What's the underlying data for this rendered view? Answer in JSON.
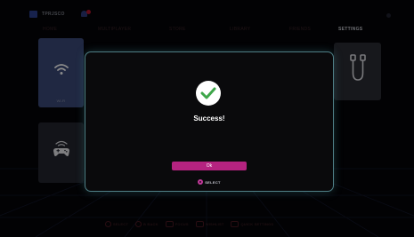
{
  "app": {
    "brand": "TPRJSCO"
  },
  "tabs": [
    {
      "label": "HOME",
      "active": false
    },
    {
      "label": "MULTIPLAYER",
      "active": false
    },
    {
      "label": "STORE",
      "active": false
    },
    {
      "label": "LIBRARY",
      "active": false
    },
    {
      "label": "FRIENDS",
      "active": false
    },
    {
      "label": "SETTINGS",
      "active": true
    }
  ],
  "tiles": {
    "wifi": {
      "icon": "wifi-icon",
      "caption": "WI-FI"
    },
    "gamepad": {
      "icon": "gamepad-icon"
    },
    "usb": {
      "icon": "usb-cable-icon"
    }
  },
  "bottom_hints": [
    {
      "label": "SELECT"
    },
    {
      "label": "B BACK"
    },
    {
      "label": "FOCUS"
    },
    {
      "label": "WISHLIST"
    },
    {
      "label": "QUICK SETTINGS"
    }
  ],
  "dialog": {
    "title": "Success!",
    "ok_label": "Ok",
    "select_hint": "SELECT",
    "icon": "check-circle-icon"
  },
  "colors": {
    "accent": "#b52380",
    "dialog_border": "#4f7f86",
    "success": "#3ea64a"
  }
}
